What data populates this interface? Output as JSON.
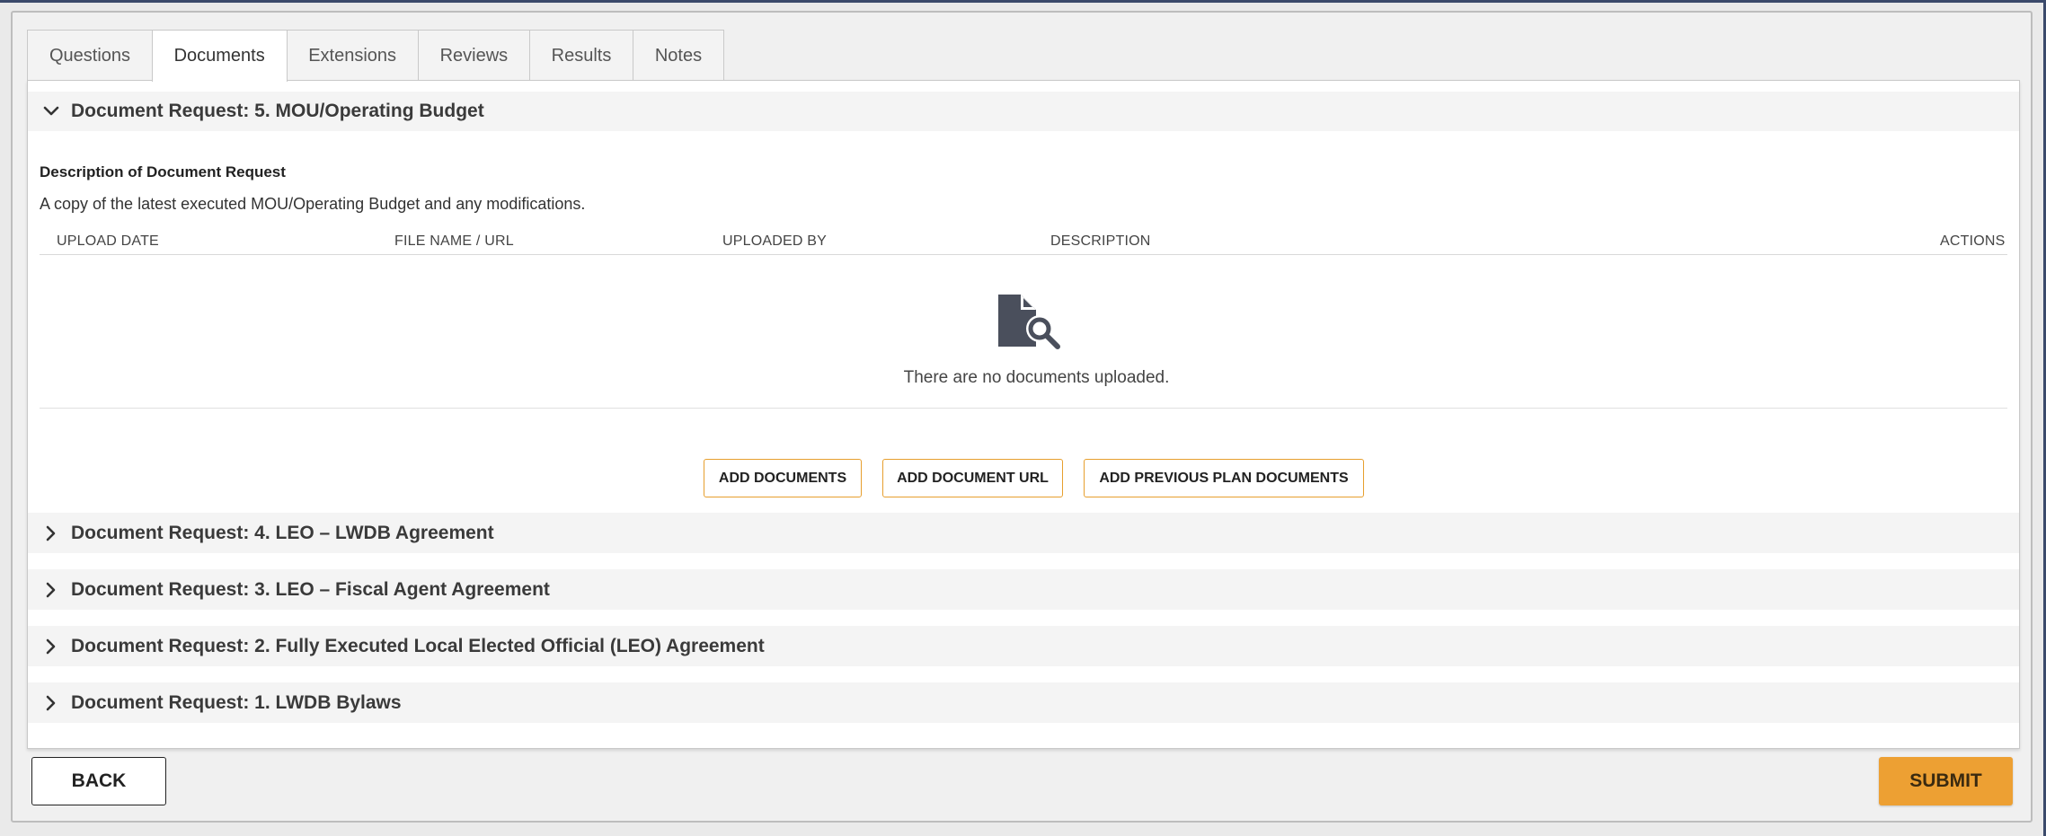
{
  "tabs": [
    "Questions",
    "Documents",
    "Extensions",
    "Reviews",
    "Results",
    "Notes"
  ],
  "active_tab": "Documents",
  "expanded_request": {
    "title": "Document Request: 5. MOU/Operating Budget",
    "description_label": "Description of Document Request",
    "description": "A copy of the latest executed MOU/Operating Budget and any modifications.",
    "columns": [
      "UPLOAD DATE",
      "FILE NAME / URL",
      "UPLOADED BY",
      "DESCRIPTION",
      "ACTIONS"
    ],
    "empty_icon": "document-search-icon",
    "empty_message": "There are no documents uploaded.",
    "buttons": {
      "add_documents": "ADD DOCUMENTS",
      "add_document_url": "ADD DOCUMENT URL",
      "add_previous_plan_documents": "ADD PREVIOUS PLAN DOCUMENTS"
    }
  },
  "collapsed_requests": [
    "Document Request: 4. LEO – LWDB Agreement",
    "Document Request: 3. LEO – Fiscal Agent Agreement",
    "Document Request: 2. Fully Executed Local Elected Official (LEO) Agreement",
    "Document Request: 1. LWDB Bylaws"
  ],
  "footer": {
    "back_label": "BACK",
    "submit_label": "SUBMIT"
  },
  "colors": {
    "accent": "#eda033",
    "button_border": "#e79f2e",
    "header_bg": "#f4f4f4",
    "frame_border": "#3b4a6b"
  }
}
